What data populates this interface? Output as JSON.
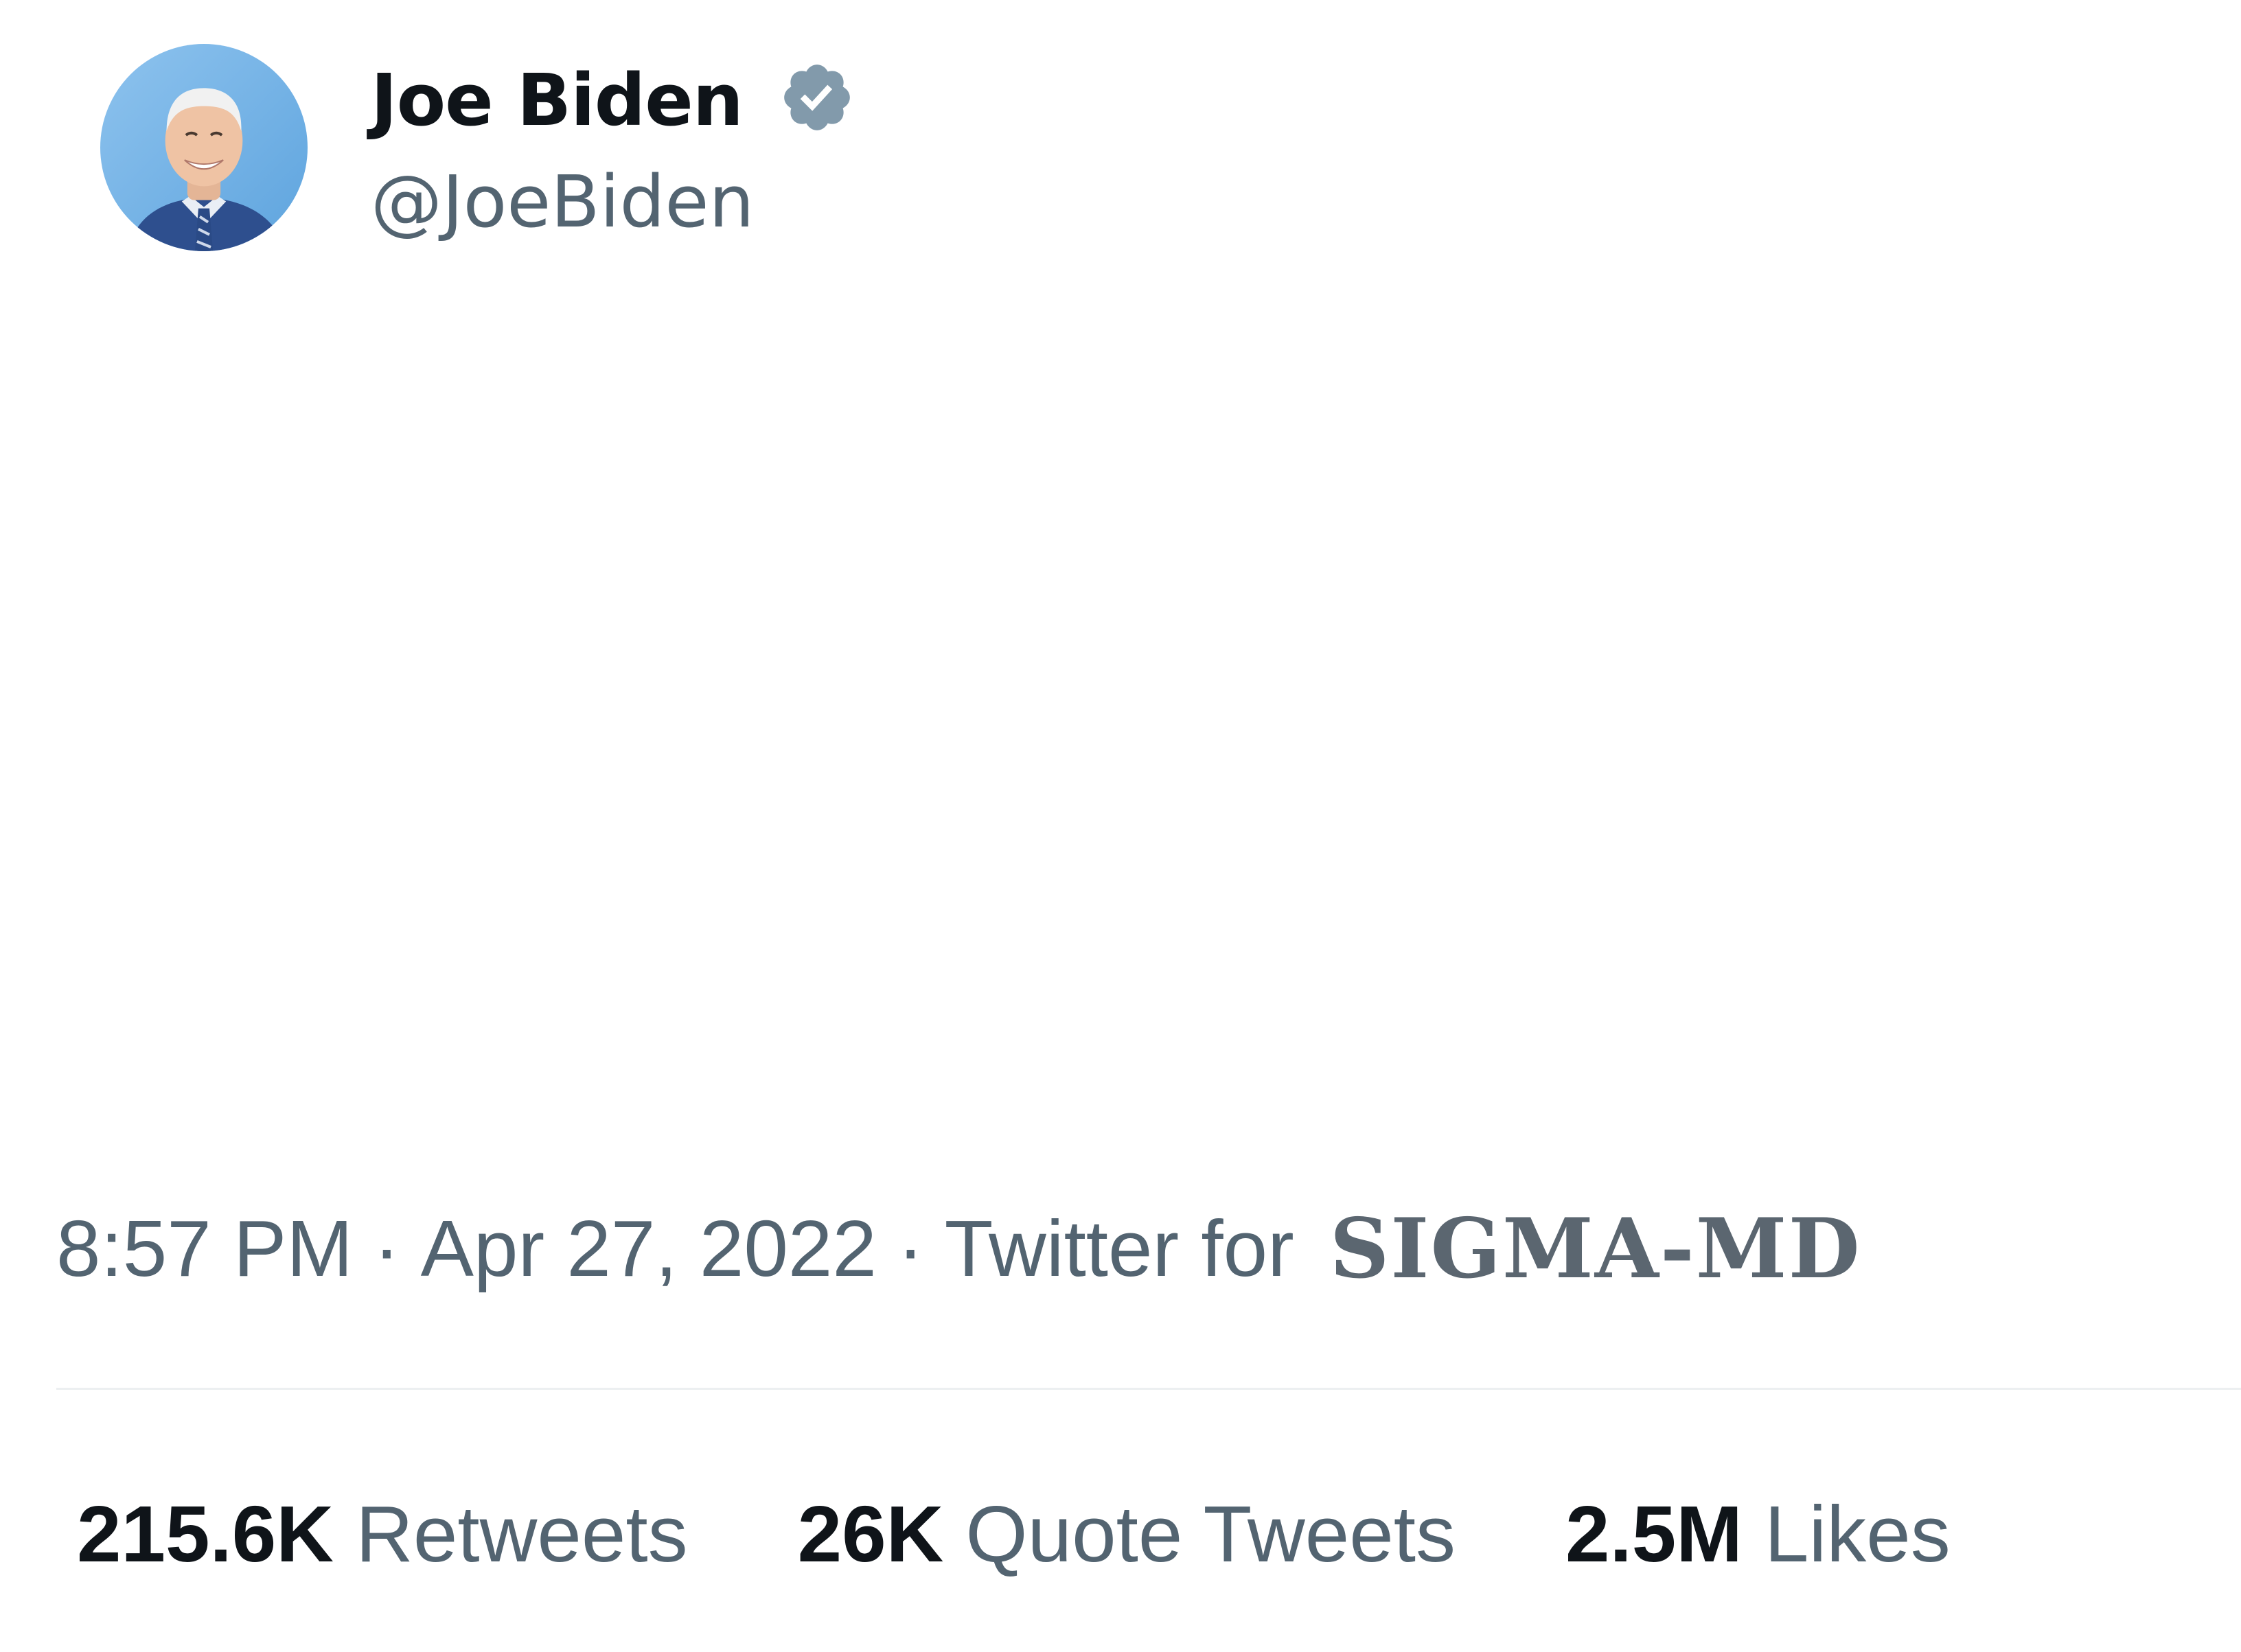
{
  "author": {
    "display_name": "Joe Biden",
    "handle": "@JoeBiden",
    "avatar": "profile-photo",
    "verified_icon": "verified-badge-icon"
  },
  "meta": {
    "time": "8:57 PM",
    "separator": "·",
    "date": "Apr 27, 2022",
    "source_prefix": "Twitter for",
    "source_app": "SIGMA-MD"
  },
  "stats": {
    "retweets": {
      "count": "215.6K",
      "label": "Retweets"
    },
    "quote_tweets": {
      "count": "26K",
      "label": "Quote Tweets"
    },
    "likes": {
      "count": "2.5M",
      "label": "Likes"
    }
  },
  "colors": {
    "text_primary": "#0f1419",
    "text_secondary": "#536471",
    "verified_badge": "#829aab",
    "divider": "#eceff1"
  }
}
